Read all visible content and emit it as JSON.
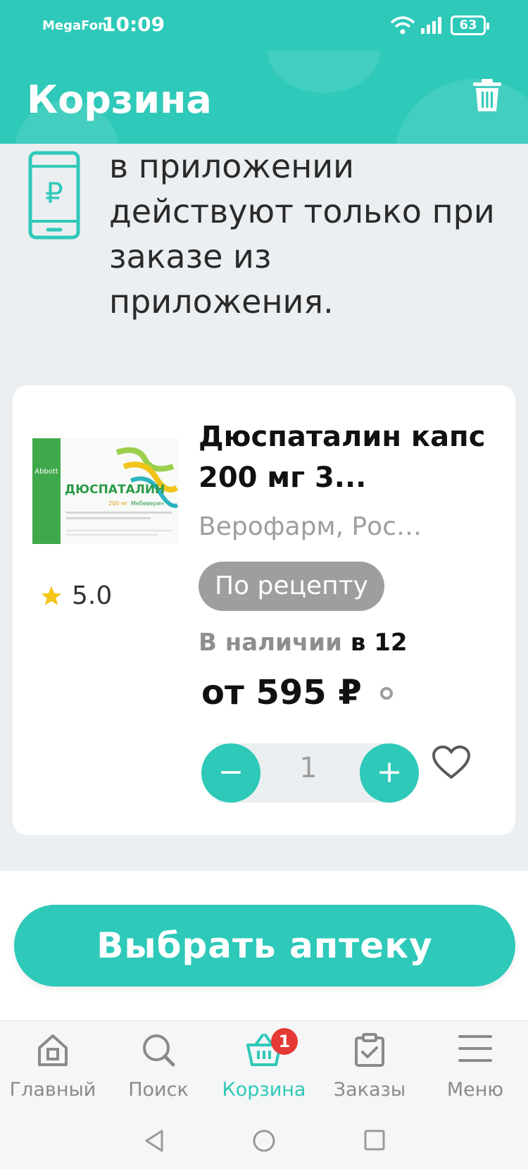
{
  "status_bar": {
    "carrier": "MegaFon",
    "time": "10:09",
    "battery": "63"
  },
  "header": {
    "title": "Корзина",
    "trash_icon": "trash-icon"
  },
  "promo": {
    "icon": "phone-ruble-icon",
    "text": "в приложении действуют только при заказе из приложения."
  },
  "product": {
    "image_label": "ДЮСПАТАЛИН",
    "image_brand": "Abbott",
    "image_dose": "200 мг",
    "image_sub": "Мебеверин",
    "rating": "5.0",
    "name": "Дюспаталин капс 200 мг 3...",
    "manufacturer": "Верофарм, Росс...",
    "badge": "По рецепту",
    "availability_label": "В наличии",
    "availability_count": "в 12",
    "price": "от 595 ₽",
    "quantity": "1",
    "minus_label": "−",
    "plus_label": "+"
  },
  "action": {
    "choose_pharmacy": "Выбрать аптеку"
  },
  "bottom_nav": {
    "items": [
      {
        "label": "Главный",
        "icon": "home-icon"
      },
      {
        "label": "Поиск",
        "icon": "search-icon"
      },
      {
        "label": "Корзина",
        "icon": "cart-icon",
        "badge": "1"
      },
      {
        "label": "Заказы",
        "icon": "orders-icon"
      },
      {
        "label": "Меню",
        "icon": "menu-icon"
      }
    ]
  },
  "colors": {
    "accent": "#2ec9b9",
    "badge_red": "#e53935",
    "muted_gray": "#9e9e9e"
  }
}
